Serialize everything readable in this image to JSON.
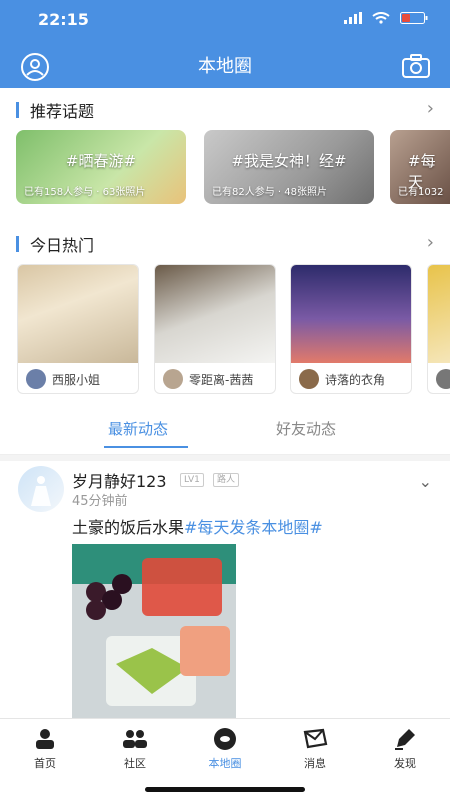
{
  "status_bar": {
    "time": "22:15"
  },
  "nav": {
    "title": "本地圈"
  },
  "sections": {
    "recommended": {
      "title": "推荐话题"
    },
    "hot_today": {
      "title": "今日热门"
    }
  },
  "topics": [
    {
      "name": "#晒春游#",
      "meta": "已有158人参与 · 63张照片"
    },
    {
      "name": "#我是女神！经#",
      "meta": "已有82人参与 · 48张照片"
    },
    {
      "name": "#每天",
      "meta": "已有1032"
    }
  ],
  "hot_cards": [
    {
      "user": "西服小姐"
    },
    {
      "user": "零距离-茜茜"
    },
    {
      "user": "诗落的衣角"
    },
    {
      "user": ""
    }
  ],
  "feed_tabs": {
    "latest": "最新动态",
    "friends": "好友动态"
  },
  "post": {
    "user": "岁月静好123",
    "level": "LV1",
    "tag": "路人",
    "time": "45分钟前",
    "text": "土豪的饭后水果",
    "hashtag": "#每天发条本地圈#"
  },
  "tabbar": {
    "items": [
      {
        "label": "首页",
        "icon": "home-icon"
      },
      {
        "label": "社区",
        "icon": "community-icon"
      },
      {
        "label": "本地圈",
        "icon": "local-circle-icon"
      },
      {
        "label": "消息",
        "icon": "message-icon"
      },
      {
        "label": "发现",
        "icon": "discover-icon"
      }
    ]
  },
  "colors": {
    "brand": "#4a90e2",
    "text": "#222222",
    "muted": "#999999"
  }
}
